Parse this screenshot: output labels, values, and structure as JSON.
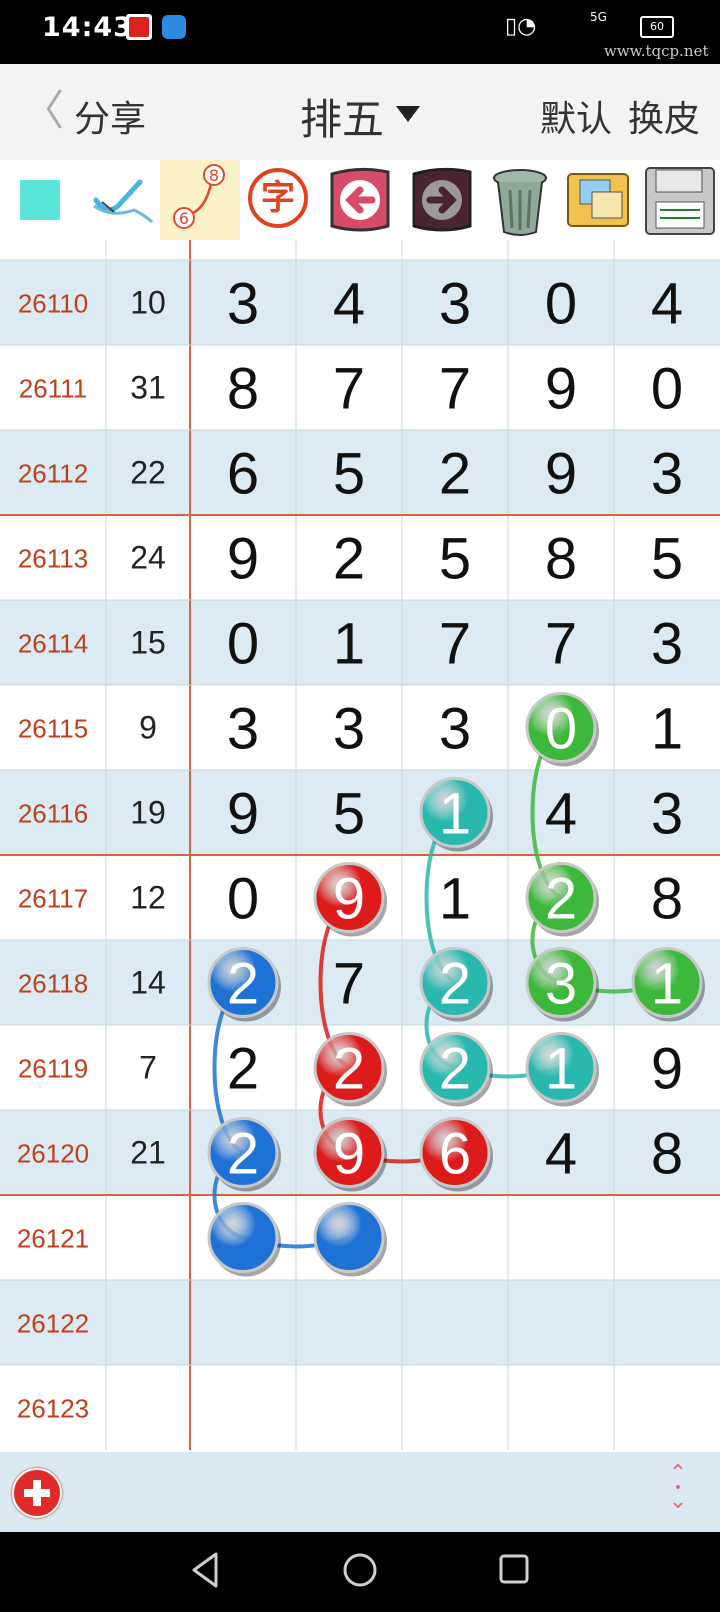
{
  "status_bar": {
    "time": "14:43",
    "network": "5G",
    "battery": "60",
    "watermark": "www.tqcp.net"
  },
  "header": {
    "back_icon": "chevron-left-icon",
    "share_label": "分享",
    "title": "排五",
    "default_label": "默认",
    "skin_label": "换皮"
  },
  "toolbar": {
    "items": [
      {
        "icon": "color-square-icon",
        "color": "#5ce4d8"
      },
      {
        "icon": "eraser-brush-icon"
      },
      {
        "icon": "connect-line-icon",
        "label_top": "8",
        "label_bottom": "6",
        "active": true
      },
      {
        "icon": "character-icon",
        "label": "字"
      },
      {
        "icon": "undo-arrow-icon"
      },
      {
        "icon": "redo-arrow-icon"
      },
      {
        "icon": "trash-can-icon"
      },
      {
        "icon": "photos-icon"
      },
      {
        "icon": "save-disk-icon"
      }
    ]
  },
  "colors": {
    "row_alt": "#dbeaf3",
    "row_plain": "#ffffff",
    "issue_text": "#c0401a",
    "separator": "#d8643f",
    "grid": "#c9d6dd",
    "blue": "#1e72d6",
    "red": "#dd1b1b",
    "teal": "#29b8ae",
    "green": "#3cb83a"
  },
  "table": {
    "rows": [
      {
        "issue": "26110",
        "sum": "10",
        "digits": [
          "3",
          "4",
          "3",
          "0",
          "4"
        ]
      },
      {
        "issue": "26111",
        "sum": "31",
        "digits": [
          "8",
          "7",
          "7",
          "9",
          "0"
        ]
      },
      {
        "issue": "26112",
        "sum": "22",
        "digits": [
          "6",
          "5",
          "2",
          "9",
          "3"
        ]
      },
      {
        "issue": "26113",
        "sum": "24",
        "digits": [
          "9",
          "2",
          "5",
          "8",
          "5"
        ]
      },
      {
        "issue": "26114",
        "sum": "15",
        "digits": [
          "0",
          "1",
          "7",
          "7",
          "3"
        ]
      },
      {
        "issue": "26115",
        "sum": "9",
        "digits": [
          "3",
          "3",
          "3",
          "0",
          "1"
        ]
      },
      {
        "issue": "26116",
        "sum": "19",
        "digits": [
          "9",
          "5",
          "1",
          "4",
          "3"
        ]
      },
      {
        "issue": "26117",
        "sum": "12",
        "digits": [
          "0",
          "9",
          "1",
          "2",
          "8"
        ]
      },
      {
        "issue": "26118",
        "sum": "14",
        "digits": [
          "2",
          "7",
          "2",
          "3",
          "1"
        ]
      },
      {
        "issue": "26119",
        "sum": "7",
        "digits": [
          "2",
          "2",
          "2",
          "1",
          "9"
        ]
      },
      {
        "issue": "26120",
        "sum": "21",
        "digits": [
          "2",
          "9",
          "6",
          "4",
          "8"
        ]
      },
      {
        "issue": "26121",
        "sum": "",
        "digits": [
          "",
          "",
          "",
          "",
          ""
        ]
      },
      {
        "issue": "26122",
        "sum": "",
        "digits": [
          "",
          "",
          "",
          "",
          ""
        ]
      },
      {
        "issue": "26123",
        "sum": "",
        "digits": [
          "",
          "",
          "",
          "",
          ""
        ]
      }
    ],
    "circles": [
      {
        "row": 5,
        "col": 3,
        "color": "green"
      },
      {
        "row": 6,
        "col": 2,
        "color": "teal"
      },
      {
        "row": 7,
        "col": 1,
        "color": "red"
      },
      {
        "row": 7,
        "col": 3,
        "color": "green"
      },
      {
        "row": 8,
        "col": 0,
        "color": "blue"
      },
      {
        "row": 8,
        "col": 2,
        "color": "teal"
      },
      {
        "row": 8,
        "col": 3,
        "color": "green"
      },
      {
        "row": 8,
        "col": 4,
        "color": "green"
      },
      {
        "row": 9,
        "col": 1,
        "color": "red"
      },
      {
        "row": 9,
        "col": 2,
        "color": "teal"
      },
      {
        "row": 9,
        "col": 3,
        "color": "teal"
      },
      {
        "row": 10,
        "col": 0,
        "color": "blue"
      },
      {
        "row": 10,
        "col": 1,
        "color": "red"
      },
      {
        "row": 10,
        "col": 2,
        "color": "red"
      },
      {
        "row": 11,
        "col": 0,
        "color": "blue"
      },
      {
        "row": 11,
        "col": 1,
        "color": "blue"
      }
    ],
    "lines": [
      {
        "color": "blue",
        "points": [
          [
            8,
            0
          ],
          [
            10,
            0
          ],
          [
            11,
            0
          ],
          [
            11,
            1
          ]
        ]
      },
      {
        "color": "red",
        "points": [
          [
            7,
            1
          ],
          [
            9,
            1
          ],
          [
            10,
            1
          ],
          [
            10,
            2
          ]
        ]
      },
      {
        "color": "teal",
        "points": [
          [
            6,
            2
          ],
          [
            8,
            2
          ],
          [
            9,
            2
          ],
          [
            9,
            3
          ]
        ]
      },
      {
        "color": "green",
        "points": [
          [
            5,
            3
          ],
          [
            7,
            3
          ],
          [
            8,
            3
          ],
          [
            8,
            4
          ]
        ]
      }
    ]
  },
  "bottom_bar": {
    "add_icon": "add-circle-icon",
    "sort_icon": "sort-updown-icon"
  },
  "nav_bar": {
    "back_icon": "nav-back-icon",
    "home_icon": "nav-home-icon",
    "recents_icon": "nav-recents-icon"
  }
}
